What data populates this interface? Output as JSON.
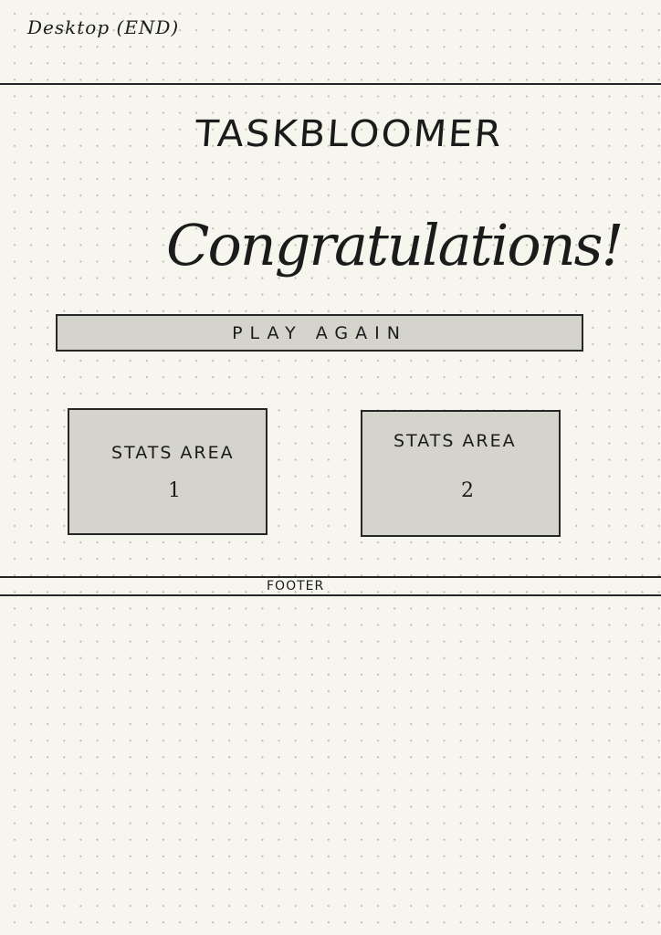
{
  "page": {
    "sheet_label": "Desktop (END)",
    "app_title": "TASKBLOOMER",
    "headline": "Congratulations!",
    "play_again_label": "PLAY AGAIN",
    "stats_areas": [
      {
        "label": "STATS AREA",
        "number": "1"
      },
      {
        "label": "STATS AREA",
        "number": "2"
      }
    ],
    "footer_label": "FOOTER"
  },
  "colors": {
    "paper": "#f7f6ee",
    "ink": "#1b1b1b",
    "box_fill": "#d4d3cc",
    "grid_dot": "#b9b8b0"
  }
}
